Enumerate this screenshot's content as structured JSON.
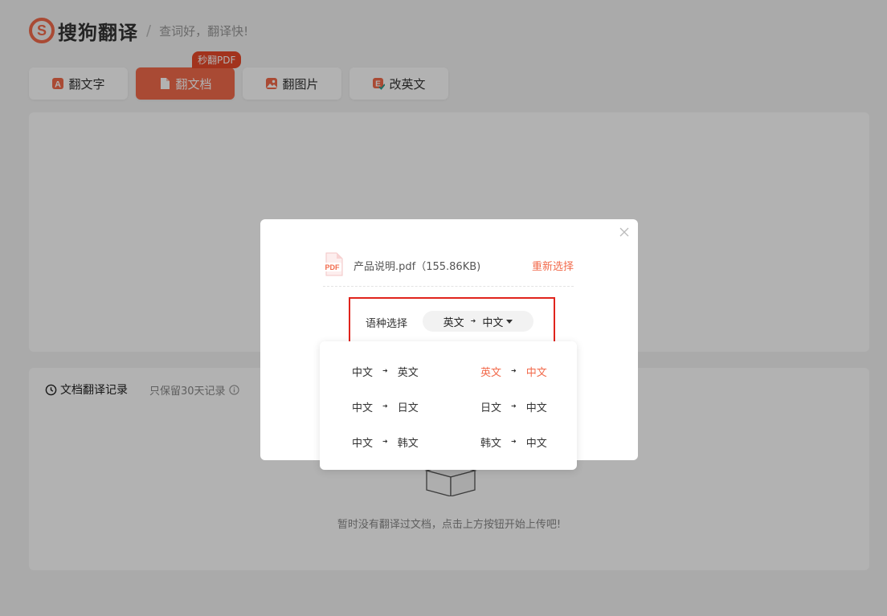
{
  "header": {
    "logo_text": "搜狗翻译",
    "separator": "/",
    "slogan": "查词好，翻译快!"
  },
  "tabs": [
    {
      "label": "翻文字",
      "icon": "text-translate-icon"
    },
    {
      "label": "翻文档",
      "icon": "document-icon",
      "badge": "秒翻PDF"
    },
    {
      "label": "翻图片",
      "icon": "image-icon"
    },
    {
      "label": "改英文",
      "icon": "edit-english-icon"
    }
  ],
  "records": {
    "title": "文档翻译记录",
    "note": "只保留30天记录",
    "empty_text": "暂时没有翻译过文档，点击上方按钮开始上传吧!"
  },
  "modal": {
    "file_name": "产品说明.pdf（155.86KB)",
    "pdf_label": "PDF",
    "reselect_label": "重新选择",
    "lang_label": "语种选择",
    "lang_source": "英文",
    "lang_target": "中文"
  },
  "dropdown": {
    "options": [
      {
        "from": "中文",
        "to": "英文"
      },
      {
        "from": "英文",
        "to": "中文",
        "selected": true
      },
      {
        "from": "中文",
        "to": "日文"
      },
      {
        "from": "日文",
        "to": "中文"
      },
      {
        "from": "中文",
        "to": "韩文"
      },
      {
        "from": "韩文",
        "to": "中文"
      }
    ]
  },
  "colors": {
    "accent": "#f26a4b",
    "badge": "#e84a2a",
    "highlight_border": "#e0241c",
    "overlay": "rgba(0,0,0,0.3)"
  }
}
